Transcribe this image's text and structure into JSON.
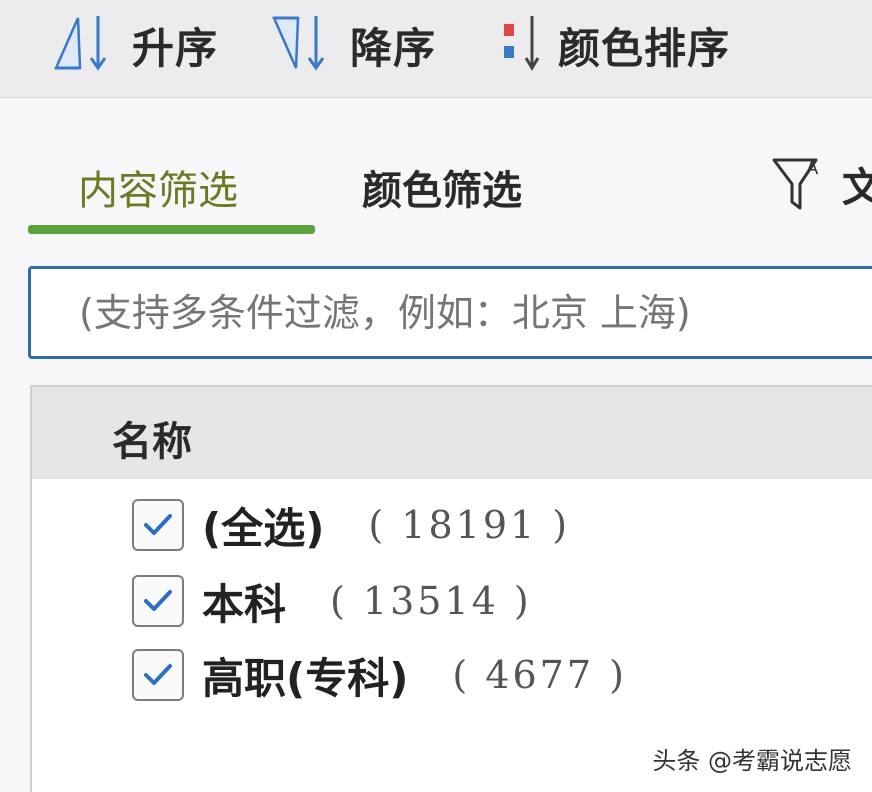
{
  "sort_toolbar": {
    "ascending_label": "升序",
    "descending_label": "降序",
    "color_sort_label": "颜色排序"
  },
  "tabs": [
    {
      "label": "内容筛选",
      "active": true
    },
    {
      "label": "颜色筛选",
      "active": false
    }
  ],
  "filter_extra_label": "文",
  "search": {
    "placeholder": "(支持多条件过滤，例如：北京 上海)"
  },
  "list": {
    "header": "名称",
    "items": [
      {
        "label": "(全选)",
        "count": "( 18191 )",
        "checked": true
      },
      {
        "label": "本科",
        "count": "( 13514 )",
        "checked": true
      },
      {
        "label": "高职(专科)",
        "count": "( 4677 )",
        "checked": true
      }
    ]
  },
  "watermark": "头条 @考霸说志愿",
  "colors": {
    "accent_green": "#5aa33a",
    "active_tab_text": "#6a7a22",
    "search_border": "#2f6ea8",
    "check_blue": "#2d6fc4",
    "sort_icon_blue": "#3a78c8",
    "sort_icon_red": "#e04848"
  }
}
